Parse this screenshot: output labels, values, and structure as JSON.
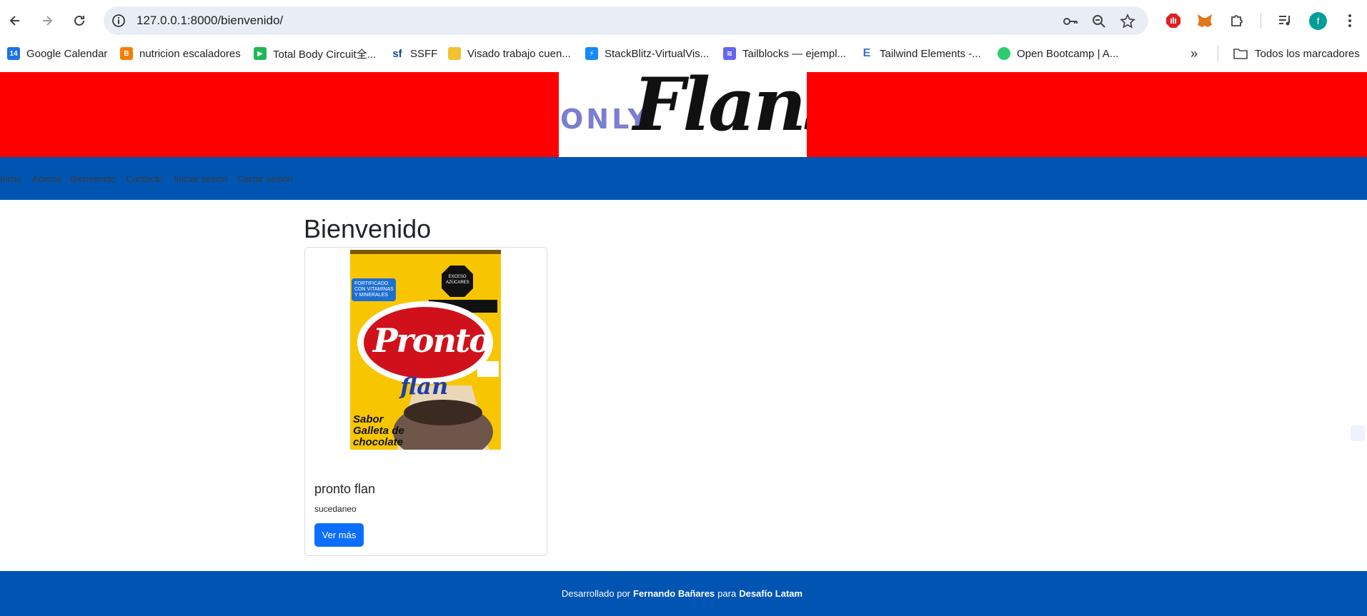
{
  "browser": {
    "url": "127.0.0.1:8000/bienvenido/",
    "profile_initial": "f",
    "bookmarks": [
      {
        "label": "Google Calendar",
        "icon": "calendar-icon",
        "color": "#1a73e8"
      },
      {
        "label": "nutricion escaladores",
        "icon": "blogger-icon",
        "color": "#f57d00"
      },
      {
        "label": "Total Body Circuit全...",
        "icon": "video-icon",
        "color": "#1db954"
      },
      {
        "label": "SSFF",
        "icon": "sf-icon",
        "color": "#0b4a8b"
      },
      {
        "label": "Visado trabajo cuen...",
        "icon": "doc-icon",
        "color": "#f1c232"
      },
      {
        "label": "StackBlitz-VirtualVis...",
        "icon": "stackblitz-icon",
        "color": "#1389fd"
      },
      {
        "label": "Tailblocks — ejempl...",
        "icon": "tailblocks-icon",
        "color": "#6366f1"
      },
      {
        "label": "Tailwind Elements -...",
        "icon": "tailwind-elements-icon",
        "color": "#3b71ca"
      },
      {
        "label": "Open Bootcamp | A...",
        "icon": "openbootcamp-icon",
        "color": "#2ecc71"
      }
    ],
    "all_bookmarks_label": "Todos los marcadores"
  },
  "site": {
    "logo_only": "ONLY",
    "logo_flans": "Flans",
    "nav": [
      "Inicio",
      "Acerca",
      "Bienvenido",
      "Contacto",
      "Iniciar sesión",
      "Cerrar sesión"
    ],
    "page_title": "Bienvenido",
    "card": {
      "title": "pronto flan",
      "text": "sucedaneo",
      "button": "Ver más",
      "image": {
        "brand": "Pronto",
        "product": "flan",
        "badge_top": "FORTIFICADO CON VITAMINAS Y MINERALES",
        "warning": "EXCESO AZÚCARES",
        "flavor": "Sabor Galleta de chocolate"
      }
    },
    "footer": {
      "prefix": "Desarrollado por",
      "author": "Fernando Bañares",
      "middle": "para",
      "org": "Desafío Latam"
    }
  },
  "colors": {
    "header_red": "#ff0000",
    "nav_blue": "#0055b3",
    "button_blue": "#0d6efd"
  }
}
